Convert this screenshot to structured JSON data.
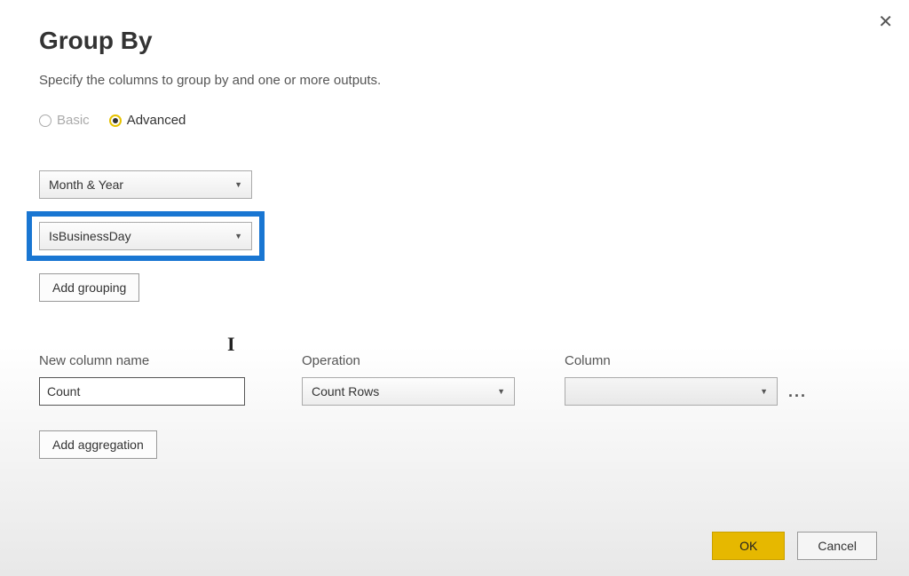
{
  "dialog": {
    "title": "Group By",
    "subtitle": "Specify the columns to group by and one or more outputs.",
    "close_label": "✕"
  },
  "mode": {
    "basic_label": "Basic",
    "advanced_label": "Advanced"
  },
  "groupings": {
    "col1": "Month & Year",
    "col2": "IsBusinessDay",
    "add_label": "Add grouping"
  },
  "aggregation": {
    "newcol_label": "New column name",
    "operation_label": "Operation",
    "column_label": "Column",
    "newcol_value": "Count",
    "operation_value": "Count Rows",
    "column_value": "",
    "add_label": "Add aggregation",
    "more": "..."
  },
  "footer": {
    "ok": "OK",
    "cancel": "Cancel"
  }
}
